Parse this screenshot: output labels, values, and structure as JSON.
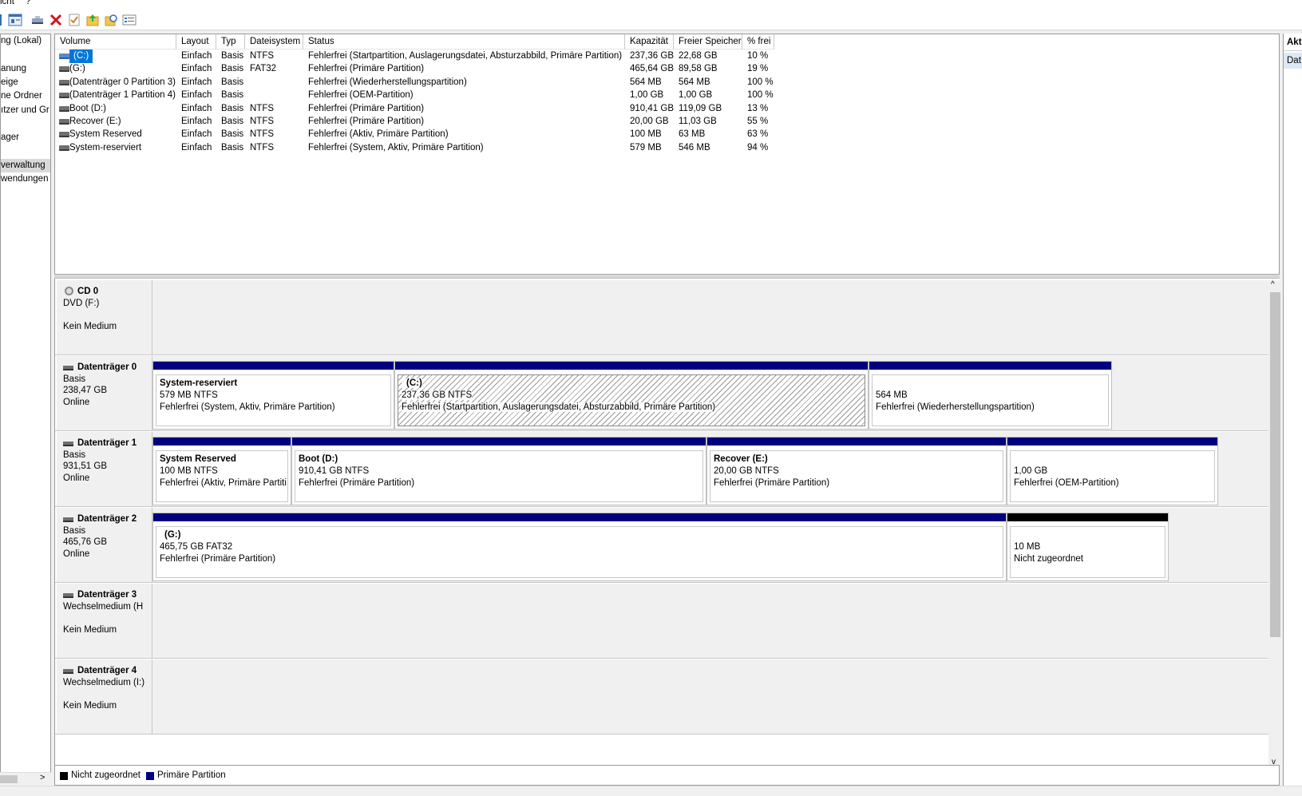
{
  "menubar": {
    "items": [
      "icht",
      "?"
    ]
  },
  "toolbar": {
    "icons": [
      "properties-icon",
      "help-view-icon",
      "connect-icon",
      "delete-icon",
      "check-icon",
      "open-folder-icon",
      "explore-icon",
      "properties-list-icon"
    ]
  },
  "tree": {
    "items": [
      "ng (Lokal)",
      "anung",
      "eige",
      "ne Ordner",
      "ıtzer und Gr",
      "ager",
      "verwaltung",
      "wendungen"
    ],
    "selected_index": 6
  },
  "volumes": {
    "columns": [
      "Volume",
      "Layout",
      "Typ",
      "Dateisystem",
      "Status",
      "Kapazität",
      "Freier Speicher",
      "% frei"
    ],
    "rows": [
      {
        "name": "(C:)",
        "layout": "Einfach",
        "type": "Basis",
        "fs": "NTFS",
        "status": "Fehlerfrei (Startpartition, Auslagerungsdatei, Absturzabbild, Primäre Partition)",
        "capacity": "237,36 GB",
        "free": "22,68 GB",
        "pct": "10 %"
      },
      {
        "name": "(G:)",
        "layout": "Einfach",
        "type": "Basis",
        "fs": "FAT32",
        "status": "Fehlerfrei (Primäre Partition)",
        "capacity": "465,64 GB",
        "free": "89,58 GB",
        "pct": "19 %"
      },
      {
        "name": "(Datenträger 0 Partition 3)",
        "layout": "Einfach",
        "type": "Basis",
        "fs": "",
        "status": "Fehlerfrei (Wiederherstellungspartition)",
        "capacity": "564 MB",
        "free": "564 MB",
        "pct": "100 %"
      },
      {
        "name": "(Datenträger 1 Partition 4)",
        "layout": "Einfach",
        "type": "Basis",
        "fs": "",
        "status": "Fehlerfrei (OEM-Partition)",
        "capacity": "1,00 GB",
        "free": "1,00 GB",
        "pct": "100 %"
      },
      {
        "name": "Boot (D:)",
        "layout": "Einfach",
        "type": "Basis",
        "fs": "NTFS",
        "status": "Fehlerfrei (Primäre Partition)",
        "capacity": "910,41 GB",
        "free": "119,09 GB",
        "pct": "13 %"
      },
      {
        "name": "Recover (E:)",
        "layout": "Einfach",
        "type": "Basis",
        "fs": "NTFS",
        "status": "Fehlerfrei (Primäre Partition)",
        "capacity": "20,00 GB",
        "free": "11,03 GB",
        "pct": "55 %"
      },
      {
        "name": "System Reserved",
        "layout": "Einfach",
        "type": "Basis",
        "fs": "NTFS",
        "status": "Fehlerfrei (Aktiv, Primäre Partition)",
        "capacity": "100 MB",
        "free": "63 MB",
        "pct": "63 %"
      },
      {
        "name": "System-reserviert",
        "layout": "Einfach",
        "type": "Basis",
        "fs": "NTFS",
        "status": "Fehlerfrei (System, Aktiv, Primäre Partition)",
        "capacity": "579 MB",
        "free": "546 MB",
        "pct": "94 %"
      }
    ]
  },
  "disks": [
    {
      "name": "CD 0",
      "l1": "DVD (F:)",
      "l2": "",
      "l3": "Kein Medium",
      "icon": "cd-drive-icon"
    },
    {
      "name": "Datenträger 0",
      "l1": "Basis",
      "l2": "238,47 GB",
      "l3": "Online",
      "icon": "disk-icon",
      "partitions": [
        {
          "title": "System-reserviert",
          "size": "579 MB NTFS",
          "status": "Fehlerfrei (System, Aktiv, Primäre Partition)"
        },
        {
          "title": "(C:)",
          "size": "237,36 GB NTFS",
          "status": "Fehlerfrei (Startpartition, Auslagerungsdatei, Absturzabbild, Primäre Partition)"
        },
        {
          "title": "",
          "size": "564 MB",
          "status": "Fehlerfrei (Wiederherstellungspartition)"
        }
      ]
    },
    {
      "name": "Datenträger 1",
      "l1": "Basis",
      "l2": "931,51 GB",
      "l3": "Online",
      "icon": "disk-icon",
      "partitions": [
        {
          "title": "System Reserved",
          "size": "100 MB NTFS",
          "status": "Fehlerfrei (Aktiv, Primäre Partiti"
        },
        {
          "title": "Boot  (D:)",
          "size": "910,41 GB NTFS",
          "status": "Fehlerfrei (Primäre Partition)"
        },
        {
          "title": "Recover  (E:)",
          "size": "20,00 GB NTFS",
          "status": "Fehlerfrei (Primäre Partition)"
        },
        {
          "title": "",
          "size": "1,00 GB",
          "status": "Fehlerfrei (OEM-Partition)"
        }
      ]
    },
    {
      "name": "Datenträger 2",
      "l1": "Basis",
      "l2": "465,76 GB",
      "l3": "Online",
      "icon": "disk-icon",
      "partitions": [
        {
          "title": "(G:)",
          "size": "465,75 GB FAT32",
          "status": "Fehlerfrei (Primäre Partition)"
        },
        {
          "title": "",
          "size": "10 MB",
          "status": "Nicht zugeordnet"
        }
      ]
    },
    {
      "name": "Datenträger 3",
      "l1": "Wechselmedium (H",
      "l2": "",
      "l3": "Kein Medium",
      "icon": "disk-icon"
    },
    {
      "name": "Datenträger 4",
      "l1": "Wechselmedium (I:)",
      "l2": "",
      "l3": "Kein Medium",
      "icon": "disk-icon"
    }
  ],
  "legend": {
    "unallocated": "Nicht zugeordnet",
    "primary": "Primäre Partition",
    "unallocated_color": "#000000",
    "primary_color": "#000080"
  },
  "actions": {
    "title": "Akt",
    "item": "Dat"
  },
  "tree_scroll": {
    "arrow": ">"
  },
  "scroll": {
    "up": "^",
    "down": "v"
  }
}
